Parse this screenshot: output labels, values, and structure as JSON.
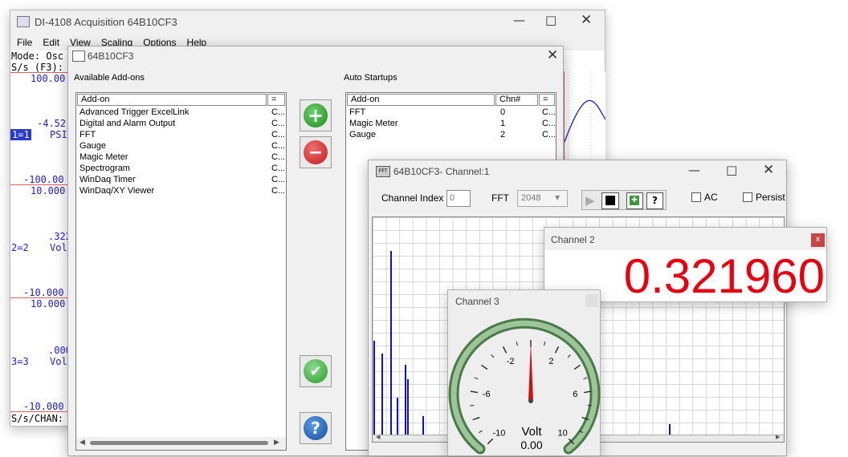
{
  "main_window": {
    "title": "DI-4108 Acquisition 64B10CF3",
    "menu": [
      "File",
      "Edit",
      "View",
      "Scaling",
      "Options",
      "Help"
    ],
    "mode_text": "Mode: Osc",
    "rate_text": "S/s (F3):",
    "channels": [
      {
        "top_value": "100.00",
        "mid_value": "-4.52",
        "id_label": "1=1",
        "unit": "PSI",
        "bottom_value": "-100.00"
      },
      {
        "top_value": "10.000",
        "mid_value": ".322",
        "id_label": "2=2",
        "unit": "Vol",
        "bottom_value": "-10.000"
      },
      {
        "top_value": "10.000",
        "mid_value": ".000",
        "id_label": "3=3",
        "unit": "Vol",
        "bottom_value": "-10.000"
      }
    ],
    "footer_text": "S/s/CHAN:"
  },
  "addon_window": {
    "title": "64B10CF3",
    "available_label": "Available Add-ons",
    "auto_label": "Auto Startups",
    "available_headers": [
      "Add-on",
      "="
    ],
    "available_items": [
      {
        "name": "Advanced Trigger ExcelLink",
        "flag": "C..."
      },
      {
        "name": "Digital and Alarm Output",
        "flag": "C..."
      },
      {
        "name": "FFT",
        "flag": "C..."
      },
      {
        "name": "Gauge",
        "flag": "C..."
      },
      {
        "name": "Magic Meter",
        "flag": "C..."
      },
      {
        "name": "Spectrogram",
        "flag": "C..."
      },
      {
        "name": "WinDaq Timer",
        "flag": "C..."
      },
      {
        "name": "WinDaq/XY Viewer",
        "flag": "C..."
      }
    ],
    "auto_headers": [
      "Add-on",
      "Chn#",
      "="
    ],
    "auto_items": [
      {
        "name": "FFT",
        "chn": "0",
        "flag": "C..."
      },
      {
        "name": "Magic Meter",
        "chn": "1",
        "flag": "C..."
      },
      {
        "name": "Gauge",
        "chn": "2",
        "flag": "C..."
      }
    ]
  },
  "fft_window": {
    "title": "64B10CF3- Channel:1",
    "channel_index_label": "Channel Index",
    "channel_index_value": "0",
    "fft_label": "FFT",
    "fft_size": "2048",
    "help_glyph": "?",
    "ac_label": "AC",
    "persist_label": "Persist"
  },
  "meter_window": {
    "title": "Channel 2",
    "close_glyph": "x",
    "value": "0.321960",
    "value_color": "#e8000e"
  },
  "gauge_window": {
    "title": "Channel 3",
    "unit": "Volt",
    "value": "0.00",
    "ticks": [
      "-10",
      "-6",
      "-2",
      "2",
      "6",
      "10"
    ],
    "needle_value": 0.0,
    "range": [
      -10,
      10
    ]
  },
  "colors": {
    "trace": "#1010cc",
    "plus_button": "#2a9a2a",
    "minus_button": "#cc2a2a",
    "help_button": "#1a5fb4"
  }
}
